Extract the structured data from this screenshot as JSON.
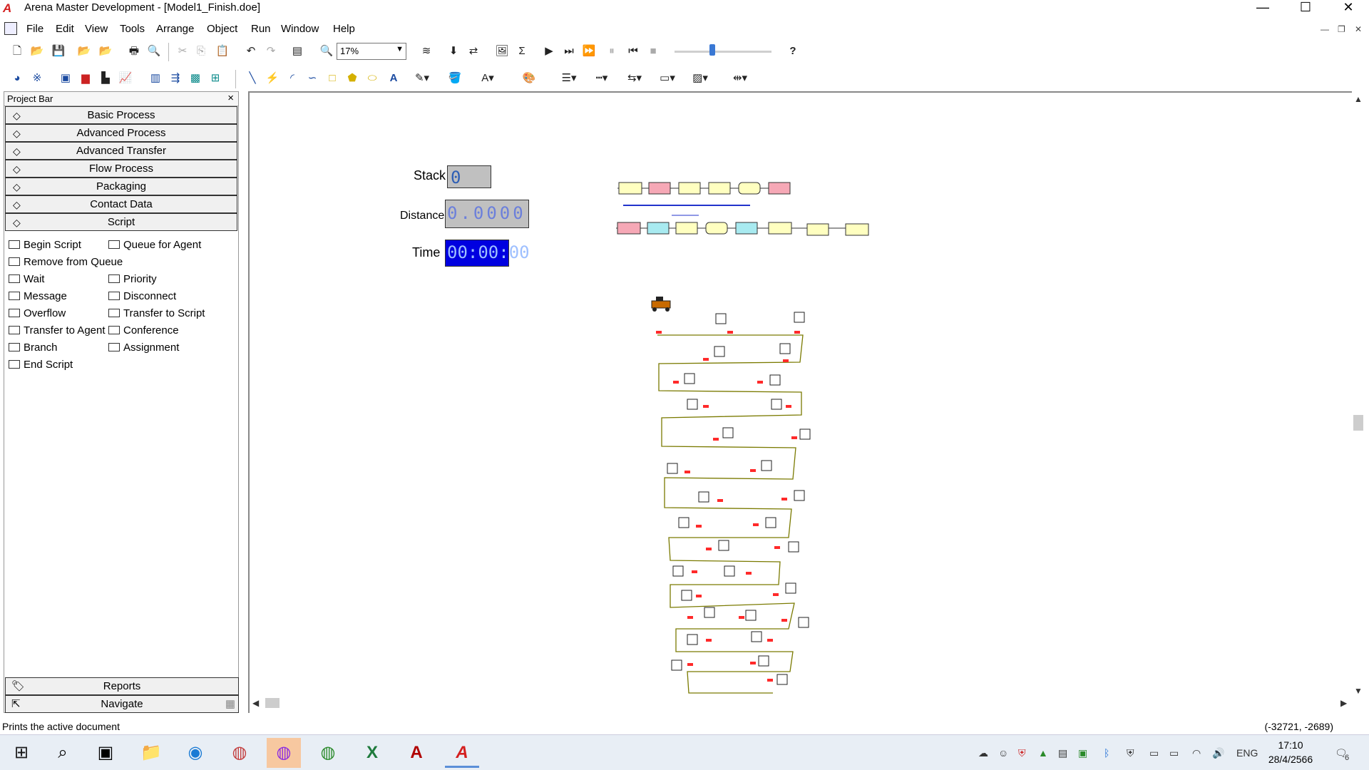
{
  "window": {
    "title": "Arena Master Development - [Model1_Finish.doe]",
    "controls": [
      "minimize-icon",
      "maximize-icon",
      "close-icon"
    ]
  },
  "menu": [
    "File",
    "Edit",
    "View",
    "Tools",
    "Arrange",
    "Object",
    "Run",
    "Window",
    "Help"
  ],
  "toolbar": {
    "zoom": "17%"
  },
  "project_bar": {
    "title": "Project Bar",
    "panels": [
      "Basic Process",
      "Advanced Process",
      "Advanced Transfer",
      "Flow Process",
      "Packaging",
      "Contact Data",
      "Script"
    ],
    "script_modules": [
      [
        "Begin Script",
        "Queue for Agent"
      ],
      [
        "Remove from Queue",
        ""
      ],
      [
        "Wait",
        "Priority"
      ],
      [
        "Message",
        "Disconnect"
      ],
      [
        "Overflow",
        "Transfer to Script"
      ],
      [
        "Transfer to Agent",
        "Conference"
      ],
      [
        "Branch",
        "Assignment"
      ],
      [
        "End Script",
        ""
      ]
    ],
    "bottom_panels": [
      "Reports",
      "Navigate"
    ]
  },
  "canvas": {
    "variables": {
      "stack_label": "Stack",
      "stack_value": "0",
      "distance_label": "Distance",
      "distance_value": "0.0000",
      "time_label": "Time",
      "time_value": "00:00:00"
    }
  },
  "status": {
    "message": "Prints the active document",
    "coords": "(-32721, -2689)"
  },
  "taskbar": {
    "language": "ENG",
    "time": "17:10",
    "date": "28/4/2566",
    "notification_count": "6"
  }
}
